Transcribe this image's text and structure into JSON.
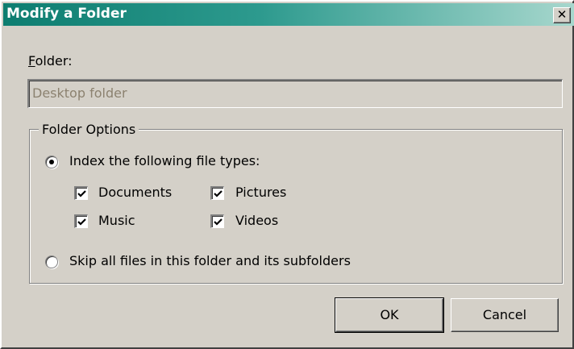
{
  "window": {
    "title": "Modify a Folder",
    "close_glyph": "✕",
    "titlebar_colors": [
      "#0d7d70",
      "#a7d7cd"
    ]
  },
  "folder": {
    "label": "Folder:",
    "value": "Desktop folder",
    "disabled": true
  },
  "options": {
    "group_label": "Folder Options",
    "index_radio": {
      "label": "Index the following file types:",
      "selected": true
    },
    "file_types": [
      {
        "label": "Documents",
        "checked": true
      },
      {
        "label": "Pictures",
        "checked": true
      },
      {
        "label": "Music",
        "checked": true
      },
      {
        "label": "Videos",
        "checked": true
      }
    ],
    "skip_radio": {
      "label": "Skip all files in this folder and its subfolders",
      "selected": false
    }
  },
  "buttons": {
    "ok": "OK",
    "cancel": "Cancel"
  }
}
